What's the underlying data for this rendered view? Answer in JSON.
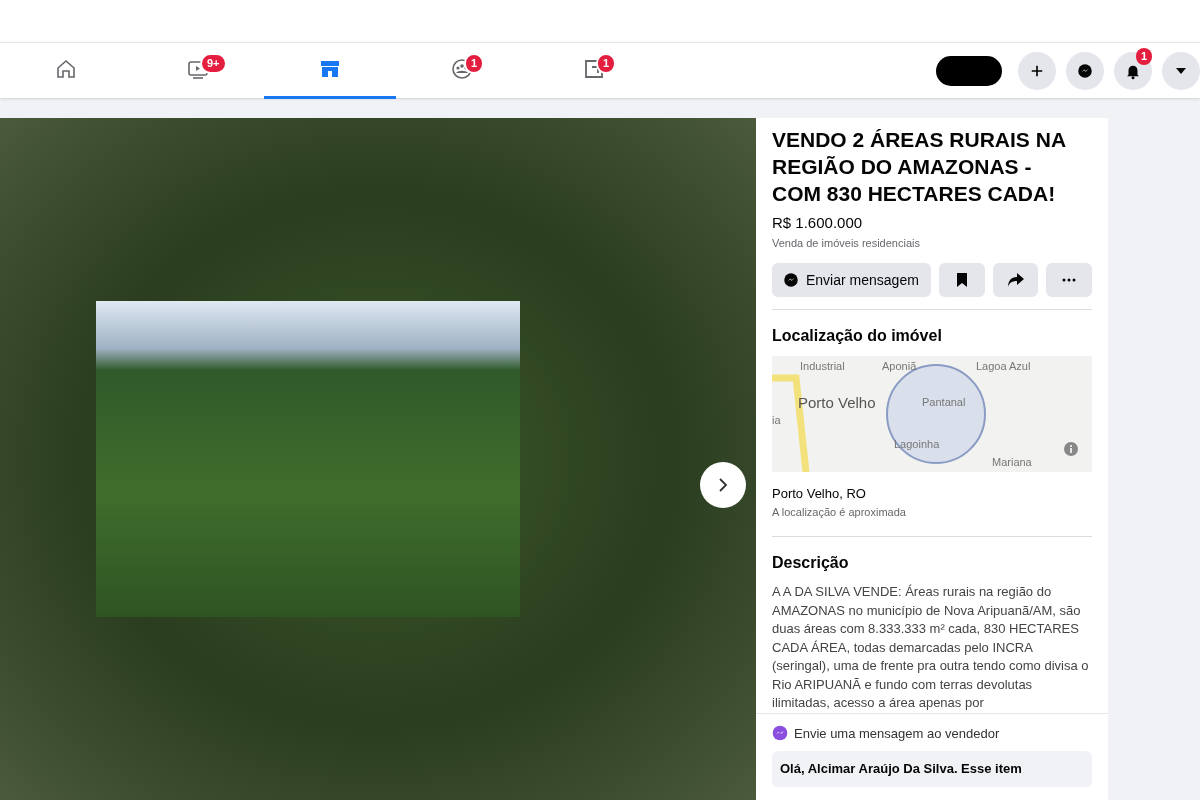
{
  "nav": {
    "tabs": [
      {
        "kind": "home",
        "selected": false
      },
      {
        "kind": "video",
        "selected": false,
        "badge": "9+"
      },
      {
        "kind": "store",
        "selected": true
      },
      {
        "kind": "groups",
        "selected": false,
        "badge": "1"
      },
      {
        "kind": "gaming",
        "selected": false,
        "badge": "1"
      }
    ],
    "actions": [
      {
        "kind": "plus"
      },
      {
        "kind": "messenger"
      },
      {
        "kind": "bell",
        "badge": "1"
      },
      {
        "kind": "caret"
      }
    ]
  },
  "listing": {
    "title": "VENDO 2 ÁREAS RURAIS NA REGIÃO DO AMAZONAS - COM 830 HECTARES CADA!",
    "price": "R$ 1.600.000",
    "category": "Venda de imóveis residenciais",
    "message_button": "Enviar mensagem",
    "location": {
      "heading": "Localização do imóvel",
      "map_labels": [
        "Industrial",
        "Aponiã",
        "Lagoa Azul",
        "Porto Velho",
        "Pantanal",
        "ia",
        "Lagoinha",
        "Mariana"
      ],
      "city": "Porto Velho, RO",
      "note": "A localização é aproximada"
    },
    "description": {
      "heading": "Descrição",
      "text": "A A DA SILVA VENDE: Áreas rurais na região do AMAZONAS no município de Nova Aripuanã/AM, são duas áreas com 8.333.333 m² cada,  830 HECTARES CADA ÁREA, todas demarcadas pelo INCRA (seringal),  uma de frente pra outra tendo como divisa o Rio ARIPUANÃ e fundo com terras devolutas ilimitadas, acesso a área apenas por"
    },
    "seller_message": {
      "label": "Envie uma mensagem ao vendedor",
      "value": "Olá, Alcimar Araújo Da Silva. Esse item"
    }
  }
}
